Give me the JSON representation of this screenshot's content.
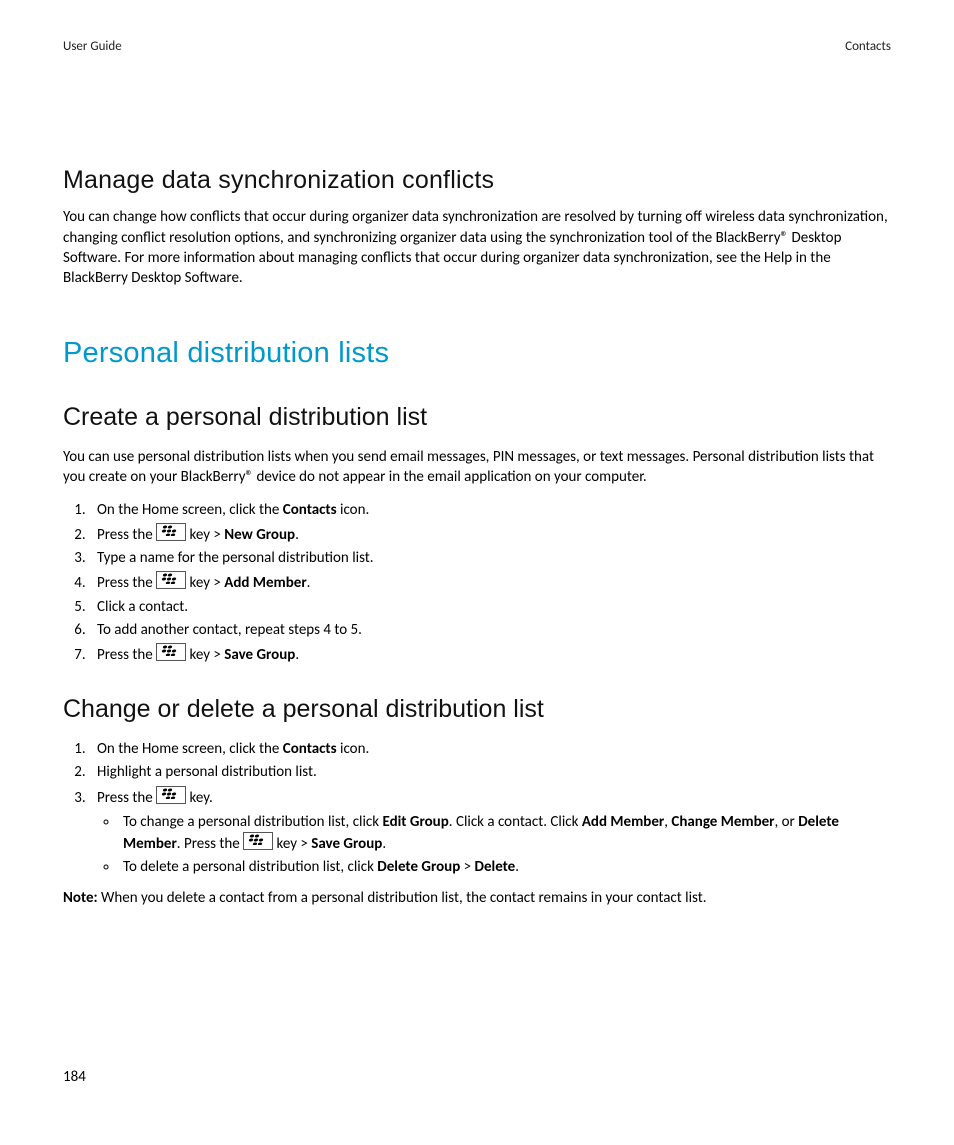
{
  "header": {
    "left": "User Guide",
    "right": "Contacts"
  },
  "section1": {
    "title": "Manage data synchronization conflicts",
    "body": "You can change how conflicts that occur during organizer data synchronization are resolved by turning off wireless data synchronization, changing conflict resolution options, and synchronizing organizer data using the synchronization tool of the BlackBerry® Desktop Software. For more information about managing conflicts that occur during organizer data synchronization, see the Help in the BlackBerry Desktop Software."
  },
  "major": {
    "title": "Personal distribution lists"
  },
  "section2": {
    "title": "Create a personal distribution list",
    "intro": "You can use personal distribution lists when you send email messages, PIN messages, or text messages. Personal distribution lists that you create on your BlackBerry® device do not appear in the email application on your computer.",
    "step1_a": "On the Home screen, click the ",
    "step1_b": "Contacts",
    "step1_c": " icon.",
    "step2_a": "Press the ",
    "step2_b": " key > ",
    "step2_c": "New Group",
    "step2_d": ".",
    "step3": "Type a name for the personal distribution list.",
    "step4_a": "Press the ",
    "step4_b": " key > ",
    "step4_c": "Add Member",
    "step4_d": ".",
    "step5": "Click a contact.",
    "step6": "To add another contact, repeat steps 4 to 5.",
    "step7_a": "Press the ",
    "step7_b": " key > ",
    "step7_c": "Save Group",
    "step7_d": "."
  },
  "section3": {
    "title": "Change or delete a personal distribution list",
    "step1_a": "On the Home screen, click the ",
    "step1_b": "Contacts",
    "step1_c": " icon.",
    "step2": "Highlight a personal distribution list.",
    "step3_a": "Press the ",
    "step3_b": " key.",
    "bullet1_a": "To change a personal distribution list, click ",
    "bullet1_b": "Edit Group",
    "bullet1_c": ". Click a contact. Click ",
    "bullet1_d": "Add Member",
    "bullet1_e": ", ",
    "bullet1_f": "Change Member",
    "bullet1_g": ", or ",
    "bullet1_h": "Delete Member",
    "bullet1_i": ". Press the ",
    "bullet1_j": " key > ",
    "bullet1_k": "Save Group",
    "bullet1_l": ".",
    "bullet2_a": "To delete a personal distribution list, click ",
    "bullet2_b": "Delete Group",
    "bullet2_c": " > ",
    "bullet2_d": "Delete",
    "bullet2_e": "."
  },
  "note": {
    "label": "Note:",
    "body": " When you delete a contact from a personal distribution list, the contact remains in your contact list."
  },
  "page_number": "184"
}
